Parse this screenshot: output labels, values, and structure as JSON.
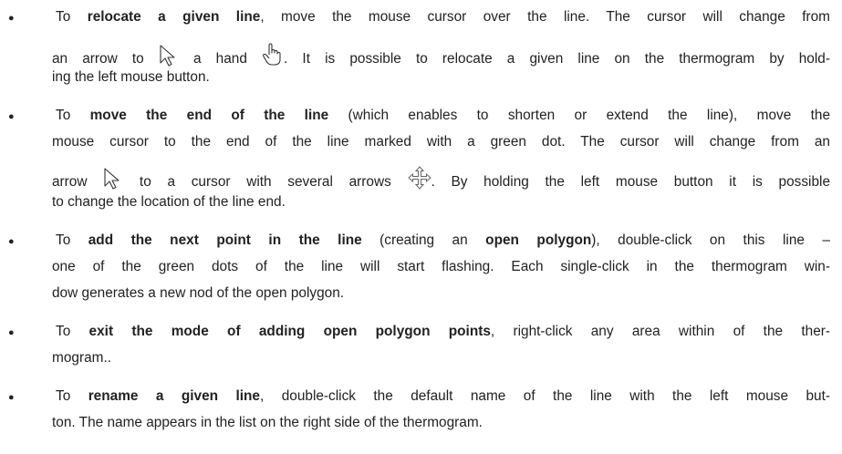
{
  "items": [
    {
      "id": "relocate",
      "lines": [
        [
          "To ",
          {
            "b": "relocate a given line"
          },
          ", move the mouse cursor over the line. The cursor will change from"
        ],
        [
          "an arrow to ",
          {
            "icon": "arrow-cursor-icon"
          },
          " a hand ",
          {
            "icon": "hand-cursor-icon"
          },
          ". It is possible to relocate a given line on the thermogram by hold-"
        ],
        [
          "ing the left mouse button."
        ]
      ]
    },
    {
      "id": "move-end",
      "lines": [
        [
          "To ",
          {
            "b": "move the end of the line"
          },
          " (which enables to shorten or extend the line), move the"
        ],
        [
          "mouse cursor to the end of the line marked with a green dot. The cursor will change from an"
        ],
        [
          "arrow ",
          {
            "icon": "arrow-cursor-icon"
          },
          " to a cursor with several arrows ",
          {
            "icon": "move-cursor-icon"
          },
          ". By holding the left mouse button it is possible"
        ],
        [
          "to change the location of the line end."
        ]
      ]
    },
    {
      "id": "add-point",
      "lines": [
        [
          "To ",
          {
            "b": "add the next point in the line"
          },
          " (creating an ",
          {
            "b": "open polygon"
          },
          "), double-click on this line –"
        ],
        [
          "one of the green dots of the line will start flashing. Each single-click in the thermogram win-"
        ],
        [
          "dow generates a new nod of the open polygon."
        ]
      ]
    },
    {
      "id": "exit-mode",
      "lines": [
        [
          "To ",
          {
            "b": "exit the mode of adding open polygon points"
          },
          ", right-click any area within of the ther-"
        ],
        [
          "mogram.."
        ]
      ]
    },
    {
      "id": "rename",
      "lines": [
        [
          "To ",
          {
            "b": "rename a given line"
          },
          ", double-click the default name of the line with the left mouse but-"
        ],
        [
          "ton. The name appears in the list on the right side of the thermogram."
        ]
      ]
    }
  ]
}
